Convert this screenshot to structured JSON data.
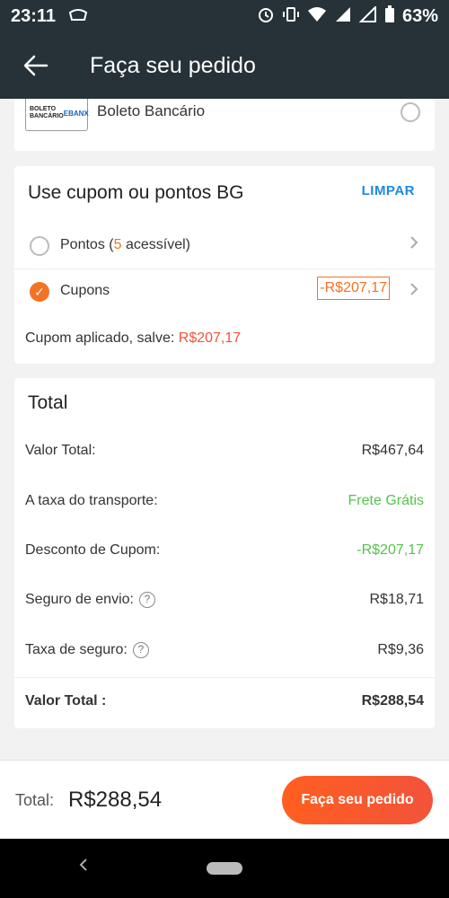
{
  "status_bar": {
    "time": "23:11",
    "battery": "63%"
  },
  "header": {
    "title": "Faça seu pedido"
  },
  "payment": {
    "method_label": "Boleto Bancário",
    "logo_line1": "BOLETO",
    "logo_line2": "BANCÁRIO",
    "logo_brand": "EBANX"
  },
  "coupon": {
    "title": "Use cupom ou pontos BG",
    "clear_label": "LIMPAR",
    "points_prefix": "Pontos (",
    "points_count": "5",
    "points_suffix": " acessível)",
    "coupons_label": "Cupons",
    "coupon_value": "-R$207,17",
    "applied_text": "Cupom aplicado, salve: ",
    "applied_value": "R$207,17"
  },
  "total": {
    "title": "Total",
    "rows": [
      {
        "label": "Valor Total:",
        "value": "R$467,64"
      },
      {
        "label": "A taxa do transporte:",
        "value": "Frete Grátis"
      },
      {
        "label": "Desconto de Cupom:",
        "value": "-R$207,17"
      },
      {
        "label": "Seguro de envio:",
        "value": "R$18,71"
      },
      {
        "label": "Taxa de seguro:",
        "value": "R$9,36"
      }
    ],
    "final_label": "Valor Total :",
    "final_value": "R$288,54"
  },
  "footer": {
    "total_label": "Total:",
    "total_value": "R$288,54",
    "button_label": "Faça seu pedido"
  },
  "colors": {
    "accent": "#f57224",
    "green": "#55c44c",
    "link": "#1e88e5",
    "header_bg": "#263238"
  }
}
